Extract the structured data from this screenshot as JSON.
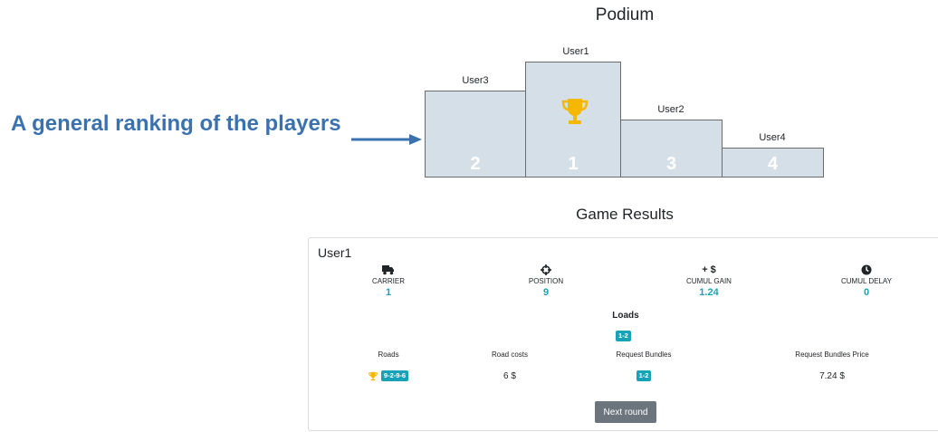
{
  "podium": {
    "title": "Podium",
    "steps": [
      {
        "user": "User3",
        "rank": "2"
      },
      {
        "user": "User1",
        "rank": "1",
        "icon": "trophy-icon"
      },
      {
        "user": "User2",
        "rank": "3"
      },
      {
        "user": "User4",
        "rank": "4"
      }
    ]
  },
  "annotation": {
    "text": "A general ranking of the players"
  },
  "results": {
    "title": "Game Results",
    "card": {
      "user": "User1",
      "stats": [
        {
          "icon": "truck-icon",
          "label": "CARRIER",
          "value": "1"
        },
        {
          "icon": "crosshair-icon",
          "label": "POSITION",
          "value": "9"
        },
        {
          "icon": "plus-dollar-icon",
          "icon_text": "+ $",
          "label": "CUMUL GAIN",
          "value": "1.24"
        },
        {
          "icon": "clock-icon",
          "label": "CUMUL DELAY",
          "value": "0"
        }
      ],
      "loads_title": "Loads",
      "loads_badge": "1-2",
      "columns": [
        {
          "label": "Roads",
          "value": "9-2-9-6",
          "icon": "trophy-icon"
        },
        {
          "label": "Road costs",
          "value": "6 $"
        },
        {
          "label": "Request Bundles",
          "value": "1-2"
        },
        {
          "label": "Request Bundles Price",
          "value": "7.24 $"
        }
      ],
      "next_button": "Next round"
    }
  },
  "colors": {
    "accent": "#17a2b8",
    "trophy": "#f5b700",
    "annotation": "#3a72b0",
    "podium_fill": "#d5dfe8",
    "button": "#6c757d"
  }
}
